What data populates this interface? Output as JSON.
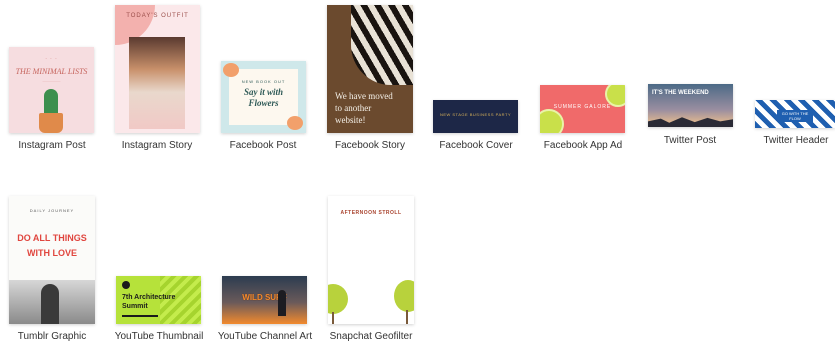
{
  "templates": [
    {
      "label": "Instagram Post",
      "design_text": [
        "THE MINIMAL LISTS"
      ],
      "colors": {
        "bg": "#f6dde0",
        "accent": "#c6655e",
        "plant": "#3d8f4e"
      }
    },
    {
      "label": "Instagram Story",
      "design_text": [
        "TODAY'S OUTFIT"
      ],
      "colors": {
        "bg": "#fbe8ea",
        "accent": "#ee8c86"
      }
    },
    {
      "label": "Facebook Post",
      "design_text": [
        "NEW BOOK OUT",
        "Say it with",
        "Flowers"
      ],
      "colors": {
        "bg": "#cfe8ea",
        "accent": "#2f5a57",
        "flower": "#f2a06b"
      }
    },
    {
      "label": "Facebook Story",
      "design_text": [
        "We have moved",
        "to another",
        "website!"
      ],
      "colors": {
        "bg": "#6b4a2e",
        "accent": "#f4f0e8"
      }
    },
    {
      "label": "Facebook Cover",
      "design_text": [
        "NEW STAGE BUSINESS PARTY"
      ],
      "colors": {
        "bg": "#1d2747",
        "accent": "#d8b25a"
      }
    },
    {
      "label": "Facebook App Ad",
      "design_text": [
        "SUMMER GALORE"
      ],
      "colors": {
        "bg": "#f06a6a",
        "accent": "#ffffff",
        "lime": "#c9e04a"
      }
    },
    {
      "label": "Twitter Post",
      "design_text": [
        "IT'S THE WEEKEND"
      ],
      "colors": {
        "bg": "#4c6a86",
        "accent": "#f6c58a"
      }
    },
    {
      "label": "Twitter Header",
      "design_text": [
        "GO WITH THE FLOW"
      ],
      "colors": {
        "bg": "#ffffff",
        "accent": "#1f5fb0"
      }
    },
    {
      "label": "Tumblr Graphic",
      "design_text": [
        "DAILY JOURNEY",
        "DO ALL THINGS",
        "WITH LOVE"
      ],
      "colors": {
        "bg": "#fbfbf9",
        "accent": "#e0463f"
      }
    },
    {
      "label": "YouTube Thumbnail",
      "design_text": [
        "7th Architecture",
        "Summit"
      ],
      "colors": {
        "bg": "#b6e23a",
        "accent": "#1b1b1b"
      }
    },
    {
      "label": "YouTube Channel Art",
      "design_text": [
        "WILD SURF"
      ],
      "colors": {
        "bg": "#2c3c50",
        "accent": "#f28a2e"
      }
    },
    {
      "label": "Snapchat Geofilter",
      "design_text": [
        "AFTERNOON STROLL"
      ],
      "colors": {
        "bg": "#ffffff",
        "accent": "#a9432e",
        "lime": "#b8d23c"
      }
    }
  ]
}
